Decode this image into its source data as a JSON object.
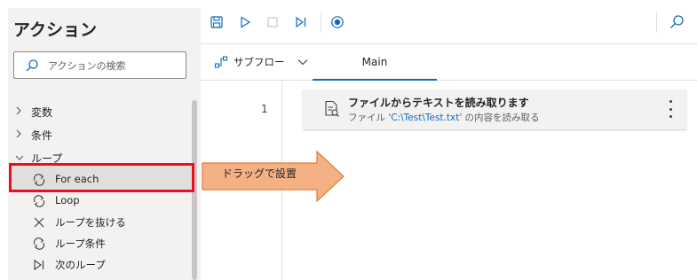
{
  "actions_pane": {
    "title": "アクション",
    "search_placeholder": "アクションの検索",
    "groups": [
      {
        "label": "変数",
        "expanded": false
      },
      {
        "label": "条件",
        "expanded": false
      },
      {
        "label": "ループ",
        "expanded": true
      }
    ],
    "loop_items": [
      {
        "label": "For each",
        "icon": "loop-icon"
      },
      {
        "label": "Loop",
        "icon": "loop-icon"
      },
      {
        "label": "ループを抜ける",
        "icon": "exit-loop-icon"
      },
      {
        "label": "ループ条件",
        "icon": "loop-icon"
      },
      {
        "label": "次のループ",
        "icon": "next-loop-icon"
      }
    ]
  },
  "toolbar": {
    "buttons": [
      "save-icon",
      "run-icon",
      "stop-icon",
      "step-icon",
      "record-icon",
      "search-icon"
    ],
    "accent": "#0f6cbd"
  },
  "tabs": {
    "subflow_label": "サブフロー",
    "main_label": "Main"
  },
  "flow": {
    "line_number": "1",
    "action_title": "ファイルからテキストを読み取ります",
    "desc_prefix": "ファイル ",
    "desc_path": "'C:\\Test\\Test.txt'",
    "desc_suffix": " の内容を読み取る"
  },
  "callout": {
    "text": "ドラッグで設置",
    "fill": "#f4b183",
    "stroke": "#e07b39"
  },
  "highlight_color": "#e81123"
}
